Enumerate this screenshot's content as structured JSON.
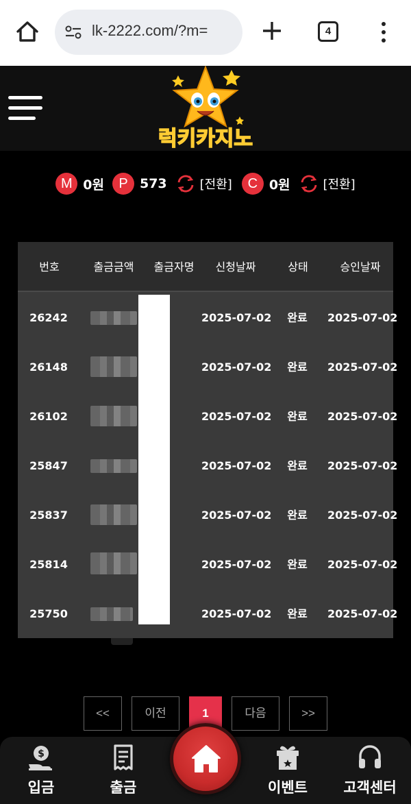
{
  "browser": {
    "url": "lk-2222.com/?m=",
    "tab_count": "4"
  },
  "site": {
    "logo_text": "럭키카지노"
  },
  "balance": {
    "m_badge": "M",
    "m_value": "0원",
    "p_badge": "P",
    "p_value": "573",
    "p_convert": "[전환]",
    "c_badge": "C",
    "c_value": "0원",
    "c_convert": "[전환]"
  },
  "table": {
    "headers": [
      "번호",
      "출금금액",
      "출금자명",
      "신청날짜",
      "상태",
      "승인날짜"
    ],
    "rows": [
      {
        "no": "26242",
        "request_date": "2025-07-02",
        "status": "완료",
        "approve_date": "2025-07-02"
      },
      {
        "no": "26148",
        "request_date": "2025-07-02",
        "status": "완료",
        "approve_date": "2025-07-02"
      },
      {
        "no": "26102",
        "request_date": "2025-07-02",
        "status": "완료",
        "approve_date": "2025-07-02"
      },
      {
        "no": "25847",
        "request_date": "2025-07-02",
        "status": "완료",
        "approve_date": "2025-07-02"
      },
      {
        "no": "25837",
        "request_date": "2025-07-02",
        "status": "완료",
        "approve_date": "2025-07-02"
      },
      {
        "no": "25814",
        "request_date": "2025-07-02",
        "status": "완료",
        "approve_date": "2025-07-02"
      },
      {
        "no": "25750",
        "request_date": "2025-07-02",
        "status": "완료",
        "approve_date": "2025-07-02"
      }
    ]
  },
  "pagination": {
    "first": "<<",
    "prev": "이전",
    "current": "1",
    "next": "다음",
    "last": ">>"
  },
  "bottom_nav": {
    "deposit": "입금",
    "withdraw": "출금",
    "event": "이벤트",
    "support": "고객센터"
  },
  "colors": {
    "accent_red": "#e5313b",
    "page_active": "#e5314a",
    "table_bg": "#3a3a3a",
    "table_head_bg": "#2c2c2c"
  }
}
